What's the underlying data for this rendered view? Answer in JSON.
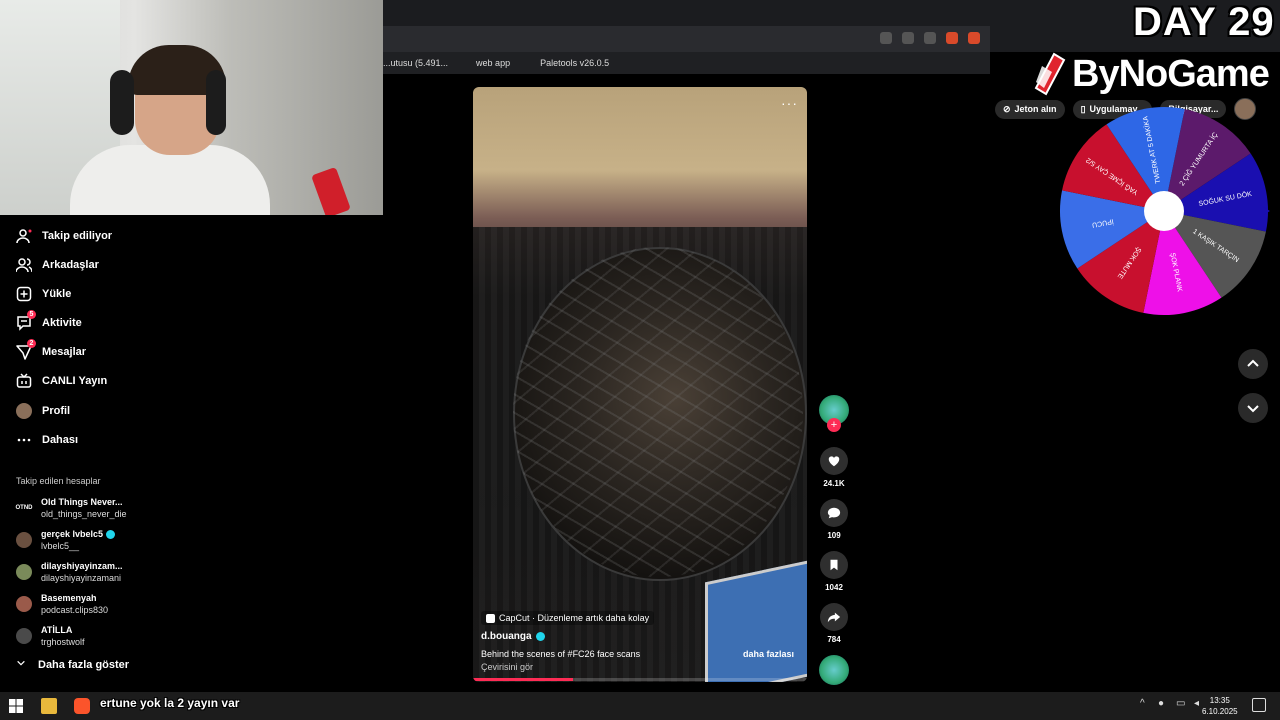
{
  "overlay": {
    "day_label": "DAY 29",
    "brand": "ByNoGame",
    "ticker": "ertune yok la 2 yayın var"
  },
  "browser": {
    "bookmarks": [
      "...utusu (5.491...",
      "web app",
      "Paletools v26.0.5"
    ]
  },
  "header": {
    "coins_label": "Jeton alın",
    "app_label": "Uygulamay...",
    "third_label": "Bilgisayar..."
  },
  "sidebar": {
    "items": [
      {
        "label": "Takip ediliyor",
        "icon": "following-icon"
      },
      {
        "label": "Arkadaşlar",
        "icon": "friends-icon"
      },
      {
        "label": "Yükle",
        "icon": "upload-icon"
      },
      {
        "label": "Aktivite",
        "icon": "activity-icon",
        "badge": "5"
      },
      {
        "label": "Mesajlar",
        "icon": "messages-icon",
        "badge": "2"
      },
      {
        "label": "CANLI Yayın",
        "icon": "live-icon"
      },
      {
        "label": "Profil",
        "icon": "profile-avatar"
      },
      {
        "label": "Dahası",
        "icon": "more-icon"
      }
    ],
    "followed_title": "Takip edilen hesaplar",
    "accounts": [
      {
        "name": "Old Things Never...",
        "user": "old_things_never_die",
        "avatar": "OTND"
      },
      {
        "name": "gerçek lvbelc5",
        "user": "lvbelc5__",
        "verified": true
      },
      {
        "name": "dilayshiyayinzam...",
        "user": "dilayshiyayinzamani"
      },
      {
        "name": "Basemenyah",
        "user": "podcast.clips830"
      },
      {
        "name": "ATİLLA",
        "user": "trghostwolf"
      }
    ],
    "show_more": "Daha fazla göster"
  },
  "video": {
    "capcut": "CapCut · Düzenleme artık daha kolay",
    "author": "d.bouanga",
    "caption": "Behind the scenes of #FC26  face scans",
    "see_more": "daha fazlası",
    "translate": "Çevirisini gör",
    "progress": 0.3
  },
  "actions": {
    "likes": "24.1K",
    "comments": "109",
    "saves": "1042",
    "shares": "784"
  },
  "wheel": {
    "segments": [
      {
        "label": "2 ÇİĞ YUMURTA İÇ",
        "color": "#5c1a6b"
      },
      {
        "label": "SOĞUK SU DÖK",
        "color": "#1a0fb0"
      },
      {
        "label": "1 KAŞIK TARÇIN",
        "color": "#555555"
      },
      {
        "label": "ŞOK PLANK",
        "color": "#ee10e8"
      },
      {
        "label": "ŞOK MUTE",
        "color": "#c8102e"
      },
      {
        "label": "İPUCU",
        "color": "#3a6ee8"
      },
      {
        "label": "YAĞ İÇME ÇAY 5/2",
        "color": "#c8102e"
      },
      {
        "label": "TWERK AT 5 DAKİKA",
        "color": "#2e67e6"
      }
    ]
  },
  "taskbar": {
    "time": "13:35",
    "date": "6.10.2025"
  }
}
